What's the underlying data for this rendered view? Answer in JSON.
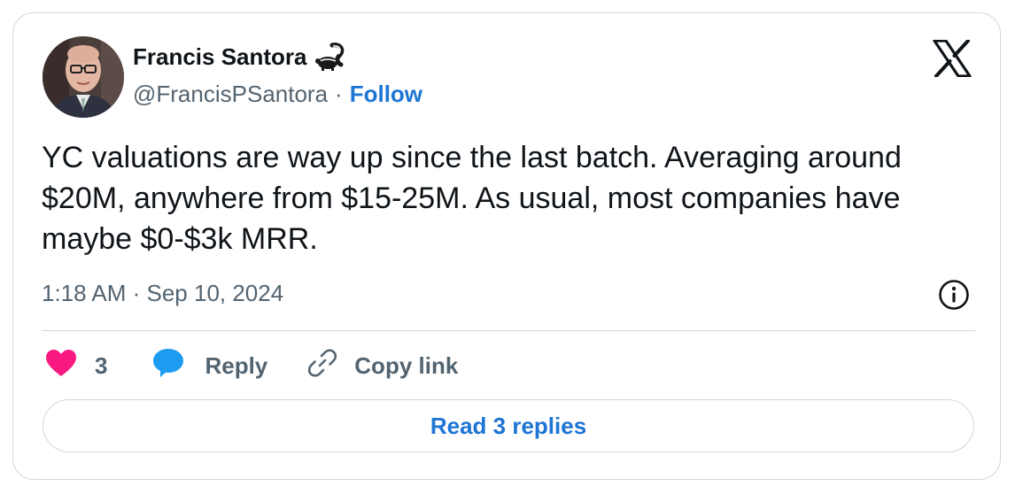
{
  "author": {
    "name": "Francis Santora",
    "handle": "@FrancisPSantora",
    "separator": "·",
    "follow_label": "Follow",
    "name_emoji_icon": "skunk-icon",
    "avatar_icon": "avatar-photo"
  },
  "brand": {
    "logo_icon": "x-logo-icon"
  },
  "tweet": {
    "text": "YC valuations are way up since the last batch. Averaging around $20M, anywhere from $15-25M. As usual, most companies have maybe $0-$3k MRR.",
    "timestamp": "1:18 AM · Sep 10, 2024",
    "info_icon": "info-icon"
  },
  "actions": {
    "like_count": "3",
    "reply_label": "Reply",
    "copy_label": "Copy link"
  },
  "footer": {
    "read_replies_label": "Read 3 replies"
  },
  "colors": {
    "text": "#0f1419",
    "secondary": "#536471",
    "link": "#1d75d4",
    "heart": "#f91880",
    "reply": "#1d9bf0",
    "border": "#cfd9de"
  }
}
